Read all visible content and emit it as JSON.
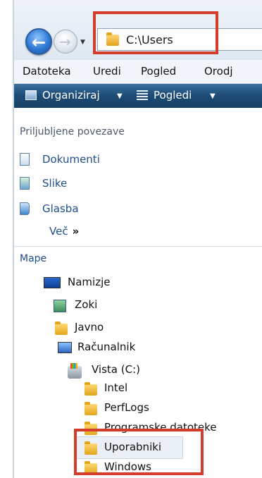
{
  "address": {
    "path": "C:\\Users"
  },
  "menu": [
    "Datoteka",
    "Uredi",
    "Pogled",
    "Orodj"
  ],
  "commands": {
    "organize": "Organiziraj",
    "views": "Pogledi"
  },
  "favorites": {
    "title": "Priljubljene povezave",
    "items": [
      "Dokumenti",
      "Slike",
      "Glasba"
    ],
    "more": "Več",
    "more_glyph": "»"
  },
  "folders": {
    "title": "Mape",
    "desktop": "Namizje",
    "user": "Zoki",
    "public": "Javno",
    "computer": "Računalnik",
    "drive": "Vista (C:)",
    "children": [
      "Intel",
      "PerfLogs",
      "Programske datoteke",
      "Uporabniki",
      "Windows"
    ]
  }
}
